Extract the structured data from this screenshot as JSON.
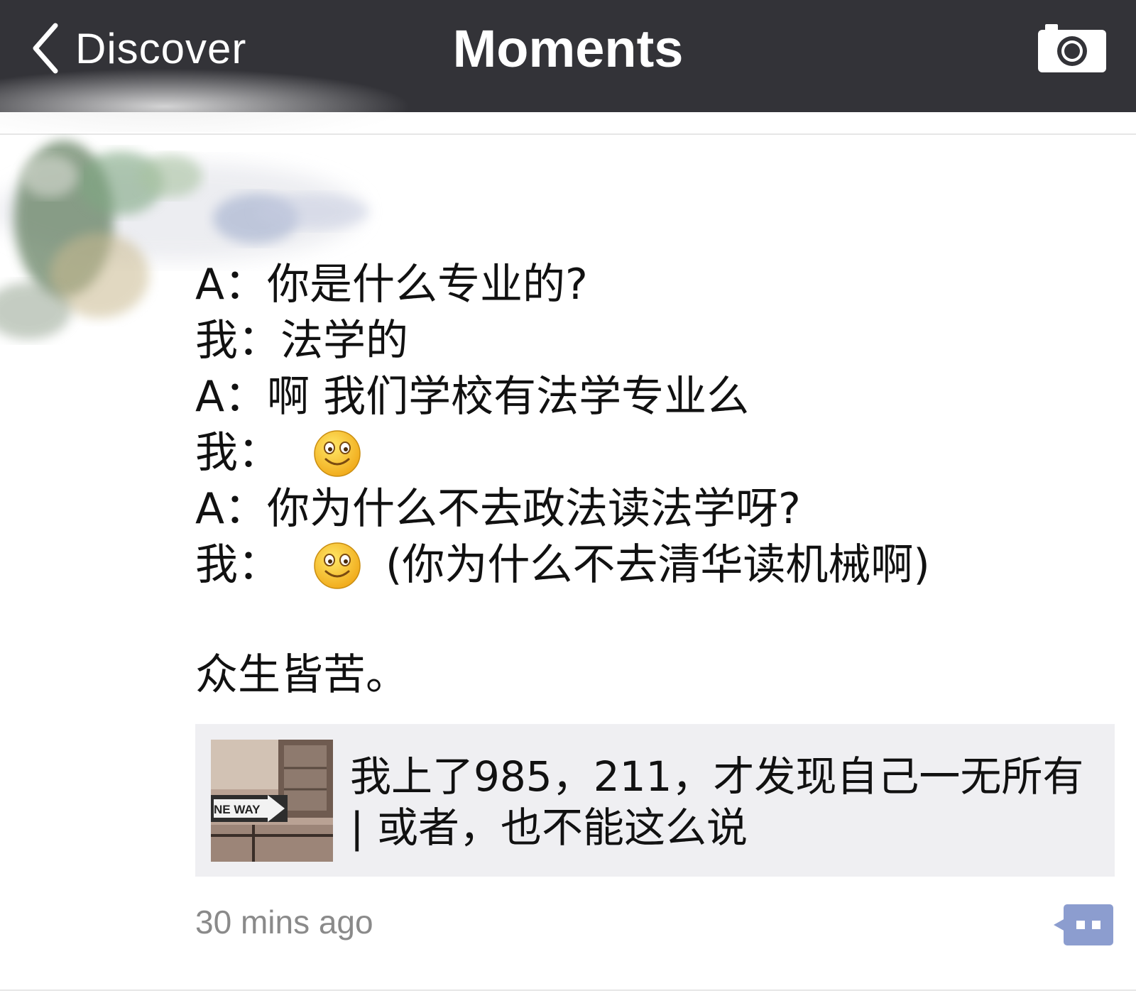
{
  "navbar": {
    "back_label": "Discover",
    "title": "Moments",
    "camera_icon": "camera-icon",
    "back_icon": "chevron-left-icon"
  },
  "post": {
    "lines": [
      {
        "speaker": "A：",
        "text": "你是什么专业的?"
      },
      {
        "speaker": "我：",
        "text": "法学的"
      },
      {
        "speaker": "A：",
        "text": "啊 我们学校有法学专业么"
      },
      {
        "speaker": "我：",
        "emoji": "smile-emoji",
        "text": ""
      },
      {
        "speaker": "A：",
        "text": "你为什么不去政法读法学呀?"
      },
      {
        "speaker": "我：",
        "emoji": "smile-emoji",
        "text": "(你为什么不去清华读机械啊)"
      }
    ],
    "coda": "众生皆苦。",
    "link_card": {
      "title": "我上了985，211，才发现自己一无所有 | 或者，也不能这么说",
      "thumbnail_text": "NE WAY"
    },
    "time": "30 mins ago",
    "comment_icon": "comment-icon"
  },
  "colors": {
    "navbar_bg": "#333338",
    "card_bg": "#efeff2",
    "comment_btn": "#8c9dcf",
    "time_text": "#8a8a8a"
  }
}
